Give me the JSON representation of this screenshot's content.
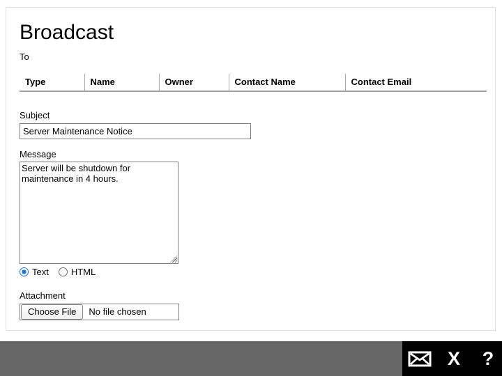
{
  "form": {
    "title": "Broadcast",
    "to_label": "To",
    "subject_label": "Subject",
    "subject_value": "Server Maintenance Notice",
    "message_label": "Message",
    "message_value": "Server will be shutdown for maintenance in 4 hours.",
    "format_options": [
      {
        "label": "Text",
        "selected": true
      },
      {
        "label": "HTML",
        "selected": false
      }
    ],
    "attachment_label": "Attachment",
    "file_button_label": "Choose File",
    "file_status_text": "No file chosen"
  },
  "recipients_table": {
    "columns": [
      "Type",
      "Name",
      "Owner",
      "Contact Name",
      "Contact Email"
    ],
    "rows": []
  },
  "bottom_bar": {
    "icons": [
      {
        "name": "mail-send",
        "glyph": "envelope"
      },
      {
        "name": "close",
        "glyph": "X"
      },
      {
        "name": "help",
        "glyph": "?"
      }
    ],
    "colors": {
      "bar": "#666667",
      "icon_area": "#000000",
      "icon": "#ffffff"
    }
  },
  "colors": {
    "radio_accent": "#1a73e8",
    "panel_border": "#e0e0e0",
    "input_border": "#7d7d7d",
    "table_rule": "#a3a3a3"
  }
}
